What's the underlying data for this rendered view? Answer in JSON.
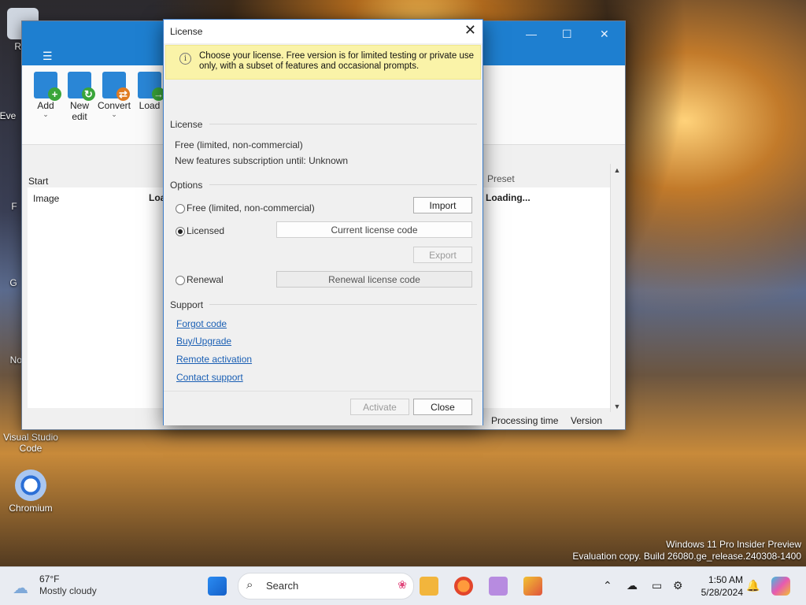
{
  "desktop": {
    "icons": [
      {
        "label": "Rec"
      },
      {
        "label": "Eve"
      },
      {
        "label": "F"
      },
      {
        "label": "G"
      },
      {
        "label": "Not"
      },
      {
        "label": "Visual Studio Code"
      },
      {
        "label": "Chromium"
      }
    ],
    "watermark": {
      "line1": "Windows 11 Pro Insider Preview",
      "line2": "Evaluation copy. Build 26080.ge_release.240308-1400"
    }
  },
  "app": {
    "menu_icon": "☰",
    "window_controls": {
      "minimize": "—",
      "maximize": "☐",
      "close": "✕"
    },
    "toolbar": [
      {
        "label": "Add",
        "badge": "+",
        "badge_color": "#3aa53a",
        "has_dropdown": true
      },
      {
        "label": "New edit",
        "badge": "↻",
        "badge_color": "#3aa53a",
        "has_dropdown": false
      },
      {
        "label": "Convert",
        "badge": "⇄",
        "badge_color": "#e07b21",
        "has_dropdown": true
      },
      {
        "label": "Load",
        "badge": "→",
        "badge_color": "#3aa53a",
        "has_dropdown": false
      }
    ],
    "left_header": "Start",
    "columns": {
      "image": "Image",
      "load": "Load"
    },
    "right_header": "Preset",
    "right_status": "Loading...",
    "status_bar": {
      "processing_time": "Processing time",
      "version": "Version"
    }
  },
  "dialog": {
    "title": "License",
    "close": "✕",
    "info_text": "Choose your license. Free version is for limited testing or private use only, with a subset of features and occasional prompts.",
    "license_section": "License",
    "license_type": "Free (limited, non-commercial)",
    "subscription": "New features subscription until: Unknown",
    "options_section": "Options",
    "options": {
      "free_label": "Free (limited, non-commercial)",
      "licensed_label": "Licensed",
      "renewal_label": "Renewal",
      "selected": "licensed"
    },
    "buttons": {
      "import": "Import",
      "current_code": "Current license code",
      "export": "Export",
      "renewal_code": "Renewal license code",
      "activate": "Activate",
      "close": "Close"
    },
    "support_section": "Support",
    "links": [
      "Forgot code",
      "Buy/Upgrade",
      "Remote activation",
      "Contact support"
    ]
  },
  "taskbar": {
    "weather_temp": "67°F",
    "weather_desc": "Mostly cloudy",
    "search_placeholder": "Search",
    "time": "1:50 AM",
    "date": "5/28/2024",
    "colors": {
      "accent": "#1e7fd0",
      "bar": "#e9ecf2"
    }
  }
}
